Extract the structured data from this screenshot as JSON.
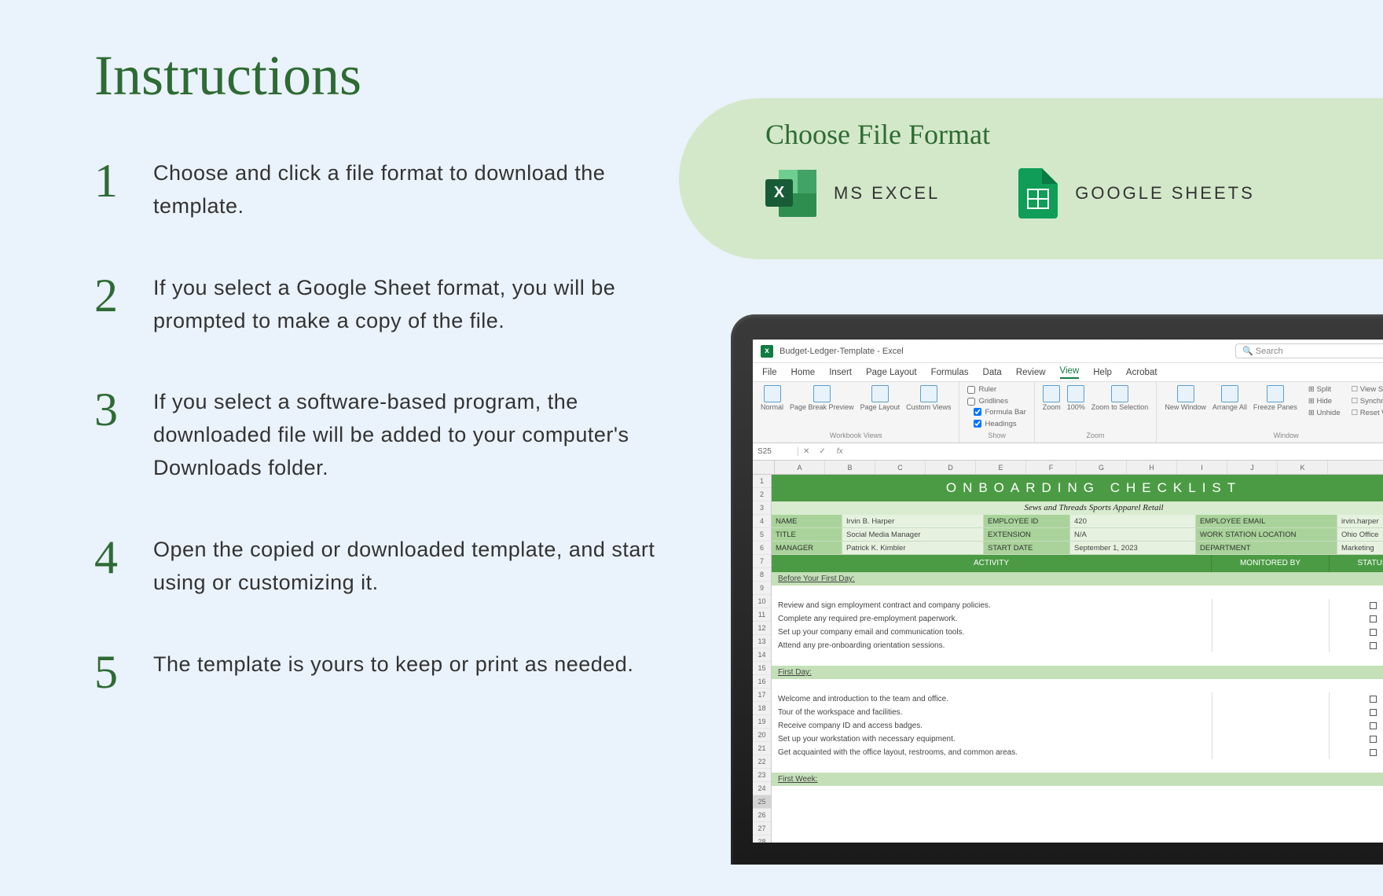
{
  "title": "Instructions",
  "steps": [
    "Choose and click a file format to download the template.",
    "If you select a Google Sheet format, you will be prompted to make a copy of the file.",
    "If you select a software-based program, the downloaded file will be added to your computer's Downloads folder.",
    "Open the copied or downloaded template, and start using or customizing it.",
    "The template is yours to keep or print as needed."
  ],
  "format": {
    "title": "Choose File Format",
    "excel_label": "MS EXCEL",
    "sheets_label": "GOOGLE SHEETS"
  },
  "excel": {
    "titlebar": "Budget-Ledger-Template  -  Excel",
    "search_placeholder": "Search",
    "menus": [
      "File",
      "Home",
      "Insert",
      "Page Layout",
      "Formulas",
      "Data",
      "Review",
      "View",
      "Help",
      "Acrobat"
    ],
    "active_menu": "View",
    "ribbon": {
      "workbook_views": {
        "label": "Workbook Views",
        "buttons": [
          "Normal",
          "Page Break Preview",
          "Page Layout",
          "Custom Views"
        ]
      },
      "show": {
        "label": "Show",
        "ruler": "Ruler",
        "formula_bar": "Formula Bar",
        "gridlines": "Gridlines",
        "headings": "Headings"
      },
      "zoom": {
        "label": "Zoom",
        "buttons": [
          "Zoom",
          "100%",
          "Zoom to Selection"
        ]
      },
      "window": {
        "label": "Window",
        "buttons": [
          "New Window",
          "Arrange All",
          "Freeze Panes"
        ],
        "side": [
          "Split",
          "Hide",
          "Unhide"
        ],
        "right": [
          "View Side b",
          "Synchronou",
          "Reset Windo"
        ]
      }
    },
    "cell_ref": "S25",
    "columns": [
      "A",
      "B",
      "C",
      "D",
      "E",
      "F",
      "G",
      "H",
      "I",
      "J",
      "K"
    ],
    "row_start": 1,
    "row_end": 28,
    "selected_row": 25,
    "sheet": {
      "banner": "ONBOARDING CHECKLIST",
      "subtitle": "Sews and Threads Sports Apparel Retail",
      "info": [
        {
          "l1": "NAME",
          "v1": "Irvin B. Harper",
          "l2": "EMPLOYEE ID",
          "v2": "420",
          "l3": "EMPLOYEE EMAIL",
          "v3": "irvin.harper"
        },
        {
          "l1": "TITLE",
          "v1": "Social Media Manager",
          "l2": "EXTENSION",
          "v2": "N/A",
          "l3": "WORK STATION LOCATION",
          "v3": "Ohio Office"
        },
        {
          "l1": "MANAGER",
          "v1": "Patrick K. Kimbler",
          "l2": "START DATE",
          "v2": "September 1, 2023",
          "l3": "DEPARTMENT",
          "v3": "Marketing"
        }
      ],
      "headers": {
        "activity": "ACTIVITY",
        "monitored": "MONITORED BY",
        "status": "STATUS"
      },
      "sections": [
        {
          "title": "Before Your First Day:",
          "items": [
            "Review and sign employment contract and company policies.",
            "Complete any required pre-employment paperwork.",
            "Set up your company email and communication tools.",
            "Attend any pre-onboarding orientation sessions."
          ]
        },
        {
          "title": "First Day:",
          "items": [
            "Welcome and introduction to the team and office.",
            "Tour of the workspace and facilities.",
            "Receive company ID and access badges.",
            "Set up your workstation with necessary equipment.",
            "Get acquainted with the office layout, restrooms, and common areas."
          ]
        },
        {
          "title": "First Week:",
          "items": []
        }
      ]
    }
  }
}
